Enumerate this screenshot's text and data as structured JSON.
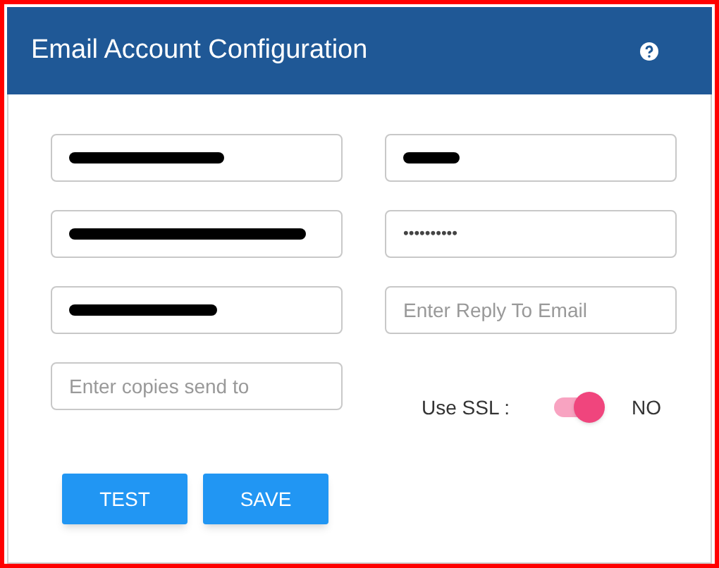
{
  "dialog": {
    "title": "Email Account Configuration"
  },
  "fields": [
    {
      "kind": "redacted"
    },
    {
      "kind": "redacted"
    },
    {
      "kind": "redacted"
    },
    {
      "kind": "password",
      "value": "••••••••••"
    },
    {
      "kind": "redacted"
    },
    {
      "kind": "empty",
      "placeholder": "Enter Reply To Email"
    },
    {
      "kind": "empty",
      "placeholder": "Enter copies send to"
    }
  ],
  "ssl": {
    "label": "Use SSL :",
    "on": true,
    "state_text": "NO"
  },
  "buttons": [
    "TEST",
    "SAVE"
  ]
}
